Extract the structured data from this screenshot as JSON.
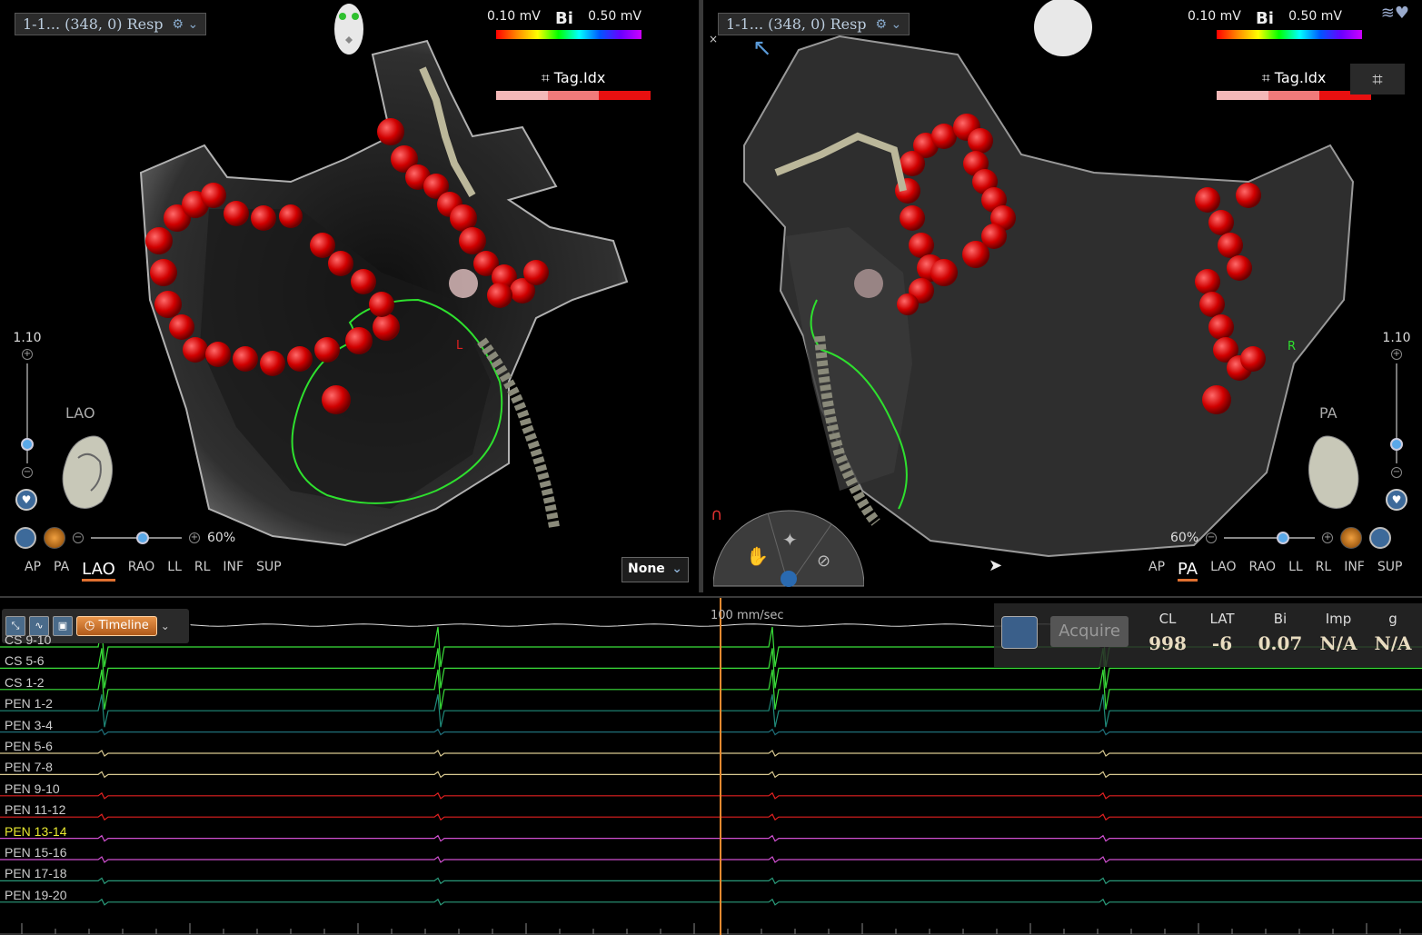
{
  "left_view": {
    "dataset": "1-1... (348, 0) Resp",
    "scale_min": "0.10 mV",
    "scale_max": "0.50 mV",
    "scale_type": "Bi",
    "tag_label": "Tag.Idx",
    "zoom_value": "1.10",
    "orientation": "LAO",
    "opacity": "60%",
    "view_buttons": [
      "AP",
      "PA",
      "LAO",
      "RAO",
      "LL",
      "RL",
      "INF",
      "SUP"
    ],
    "active_view": "LAO",
    "coloring_select": "None",
    "zoom_level": 0.25,
    "opacity_level": 0.6
  },
  "right_view": {
    "dataset": "1-1... (348, 0) Resp",
    "scale_min": "0.10 mV",
    "scale_max": "0.50 mV",
    "scale_type": "Bi",
    "tag_label": "Tag.Idx",
    "zoom_value": "1.10",
    "orientation": "PA",
    "opacity": "60%",
    "view_buttons": [
      "AP",
      "PA",
      "LAO",
      "RAO",
      "LL",
      "RL",
      "INF",
      "SUP"
    ],
    "active_view": "PA",
    "zoom_level": 0.25,
    "opacity_level": 0.6
  },
  "anatomy_labels": {
    "left_marker": "L",
    "right_marker": "R"
  },
  "tag_colors": [
    "#f4b8b8",
    "#f07a7a",
    "#e81010"
  ],
  "ecg": {
    "toolbar": {
      "timeline_label": "Timeline"
    },
    "sweep_speed": "100 mm/sec",
    "channels": [
      {
        "label": "CS 9-10",
        "color": "#3ae03a"
      },
      {
        "label": "CS 5-6",
        "color": "#3ae03a"
      },
      {
        "label": "CS 1-2",
        "color": "#3ae03a"
      },
      {
        "label": "PEN 1-2",
        "color": "#1f8a7a"
      },
      {
        "label": "PEN 3-4",
        "color": "#1f6f7a"
      },
      {
        "label": "PEN 5-6",
        "color": "#d8c890"
      },
      {
        "label": "PEN 7-8",
        "color": "#d8c890"
      },
      {
        "label": "PEN 9-10",
        "color": "#e02020"
      },
      {
        "label": "PEN 11-12",
        "color": "#e02020"
      },
      {
        "label": "PEN 13-14",
        "color": "#d050d0"
      },
      {
        "label": "PEN 15-16",
        "color": "#d050d0"
      },
      {
        "label": "PEN 17-18",
        "color": "#2a9a7a"
      },
      {
        "label": "PEN 19-20",
        "color": "#2a9a7a"
      }
    ],
    "highlight_channel": "PEN 13-14",
    "highlight_color": "#e8e830"
  },
  "readout": {
    "acquire_label": "Acquire",
    "columns": [
      {
        "header": "CL",
        "value": "998"
      },
      {
        "header": "LAT",
        "value": "-6"
      },
      {
        "header": "Bi",
        "value": "0.07"
      },
      {
        "header": "Imp",
        "value": "N/A"
      },
      {
        "header": "g",
        "value": "N/A"
      }
    ]
  }
}
